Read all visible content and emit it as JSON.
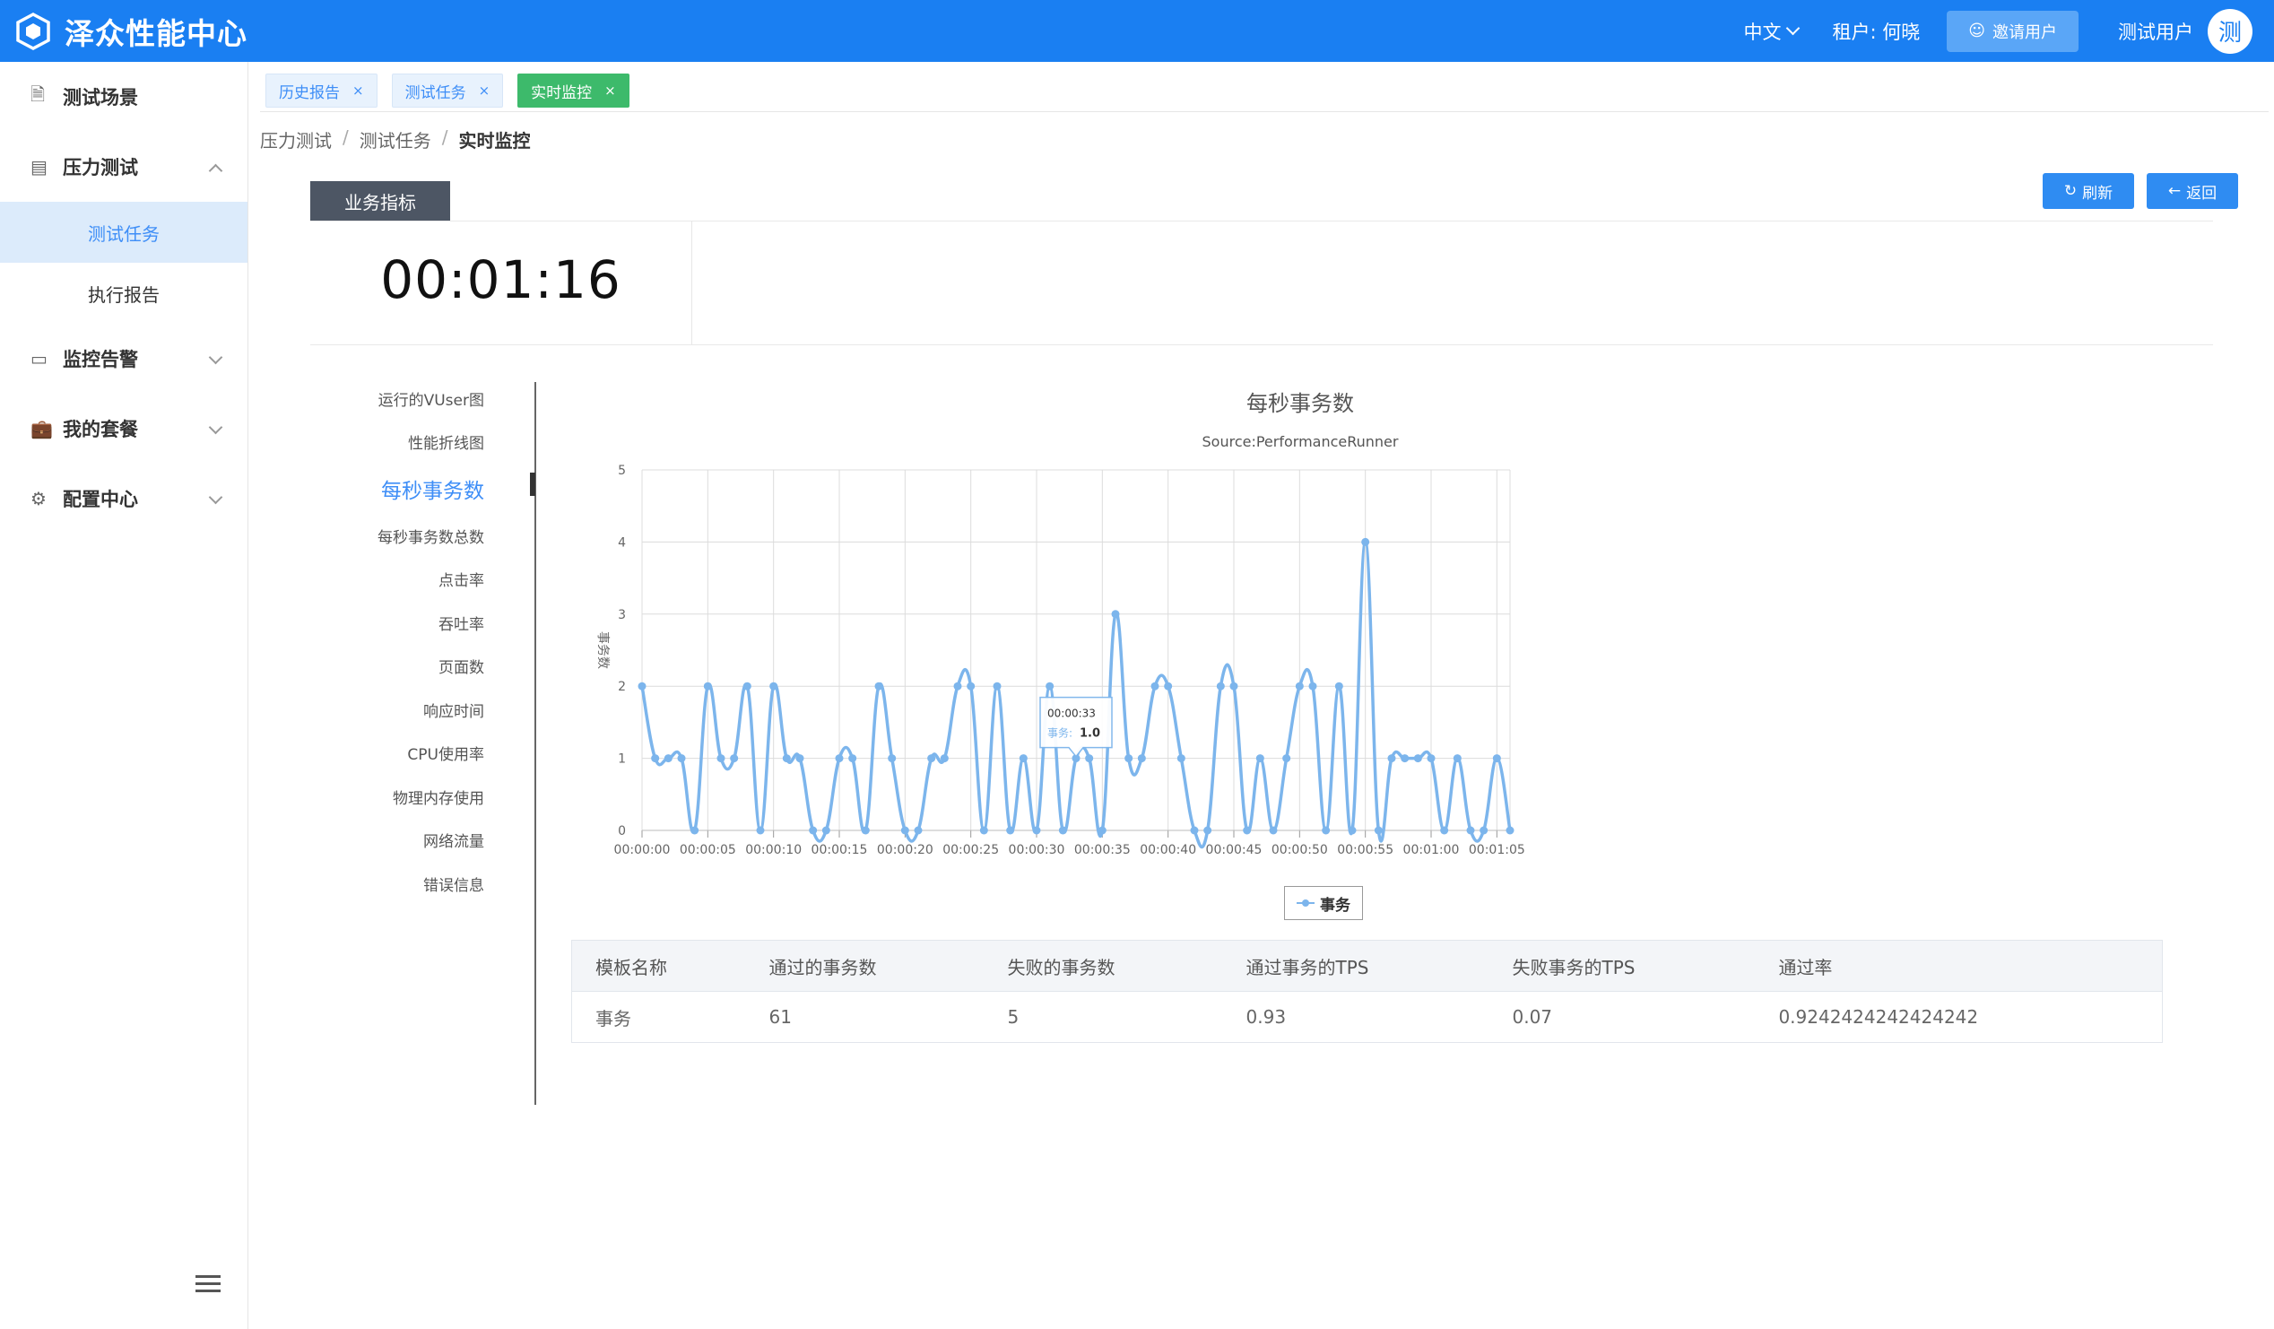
{
  "header": {
    "brand_name": "泽众性能中心",
    "language": "中文",
    "tenant": "租户: 何晓",
    "invite_label": "邀请用户",
    "username": "测试用户",
    "avatar_text": "测"
  },
  "sidebar": {
    "items": [
      {
        "label": "测试场景",
        "icon": "document-icon"
      },
      {
        "label": "压力测试",
        "icon": "monitor-icon",
        "expanded": true,
        "children": [
          {
            "label": "测试任务",
            "active": true
          },
          {
            "label": "执行报告"
          }
        ]
      },
      {
        "label": "监控告警",
        "icon": "desktop-icon"
      },
      {
        "label": "我的套餐",
        "icon": "bag-icon"
      },
      {
        "label": "配置中心",
        "icon": "gear-icon"
      }
    ]
  },
  "tabs": [
    {
      "label": "历史报告",
      "active": false
    },
    {
      "label": "测试任务",
      "active": false
    },
    {
      "label": "实时监控",
      "active": true
    }
  ],
  "breadcrumb": [
    "压力测试",
    "测试任务",
    "实时监控"
  ],
  "section_tab": "业务指标",
  "buttons": {
    "refresh": "刷新",
    "back": "返回"
  },
  "timer": "00:01:16",
  "chart_nav": [
    {
      "label": "运行的VUser图"
    },
    {
      "label": "性能折线图"
    },
    {
      "label": "每秒事务数",
      "active": true
    },
    {
      "label": "每秒事务数总数"
    },
    {
      "label": "点击率"
    },
    {
      "label": "吞吐率"
    },
    {
      "label": "页面数"
    },
    {
      "label": "响应时间"
    },
    {
      "label": "CPU使用率"
    },
    {
      "label": "物理内存使用"
    },
    {
      "label": "网络流量"
    },
    {
      "label": "错误信息"
    }
  ],
  "chart_data": {
    "type": "line",
    "title": "每秒事务数",
    "subtitle": "Source:PerformanceRunner",
    "ylabel": "事务数",
    "xlabel": "",
    "ylim": [
      0,
      5
    ],
    "yticks": [
      0,
      1,
      2,
      3,
      4,
      5
    ],
    "xticks": [
      "00:00:00",
      "00:00:05",
      "00:00:10",
      "00:00:15",
      "00:00:20",
      "00:00:25",
      "00:00:30",
      "00:00:35",
      "00:00:40",
      "00:00:45",
      "00:00:50",
      "00:00:55",
      "00:01:00",
      "00:01:05"
    ],
    "grid": true,
    "legend": "bottom-center",
    "series": [
      {
        "name": "事务",
        "color": "#7cb5ec",
        "values": [
          2,
          1,
          1,
          1,
          0,
          2,
          1,
          1,
          2,
          0,
          2,
          1,
          1,
          0,
          0,
          1,
          1,
          0,
          2,
          1,
          0,
          0,
          1,
          1,
          2,
          2,
          0,
          2,
          0,
          1,
          0,
          2,
          0,
          1,
          1,
          0,
          3,
          1,
          1,
          2,
          2,
          1,
          0,
          0,
          2,
          2,
          0,
          1,
          0,
          1,
          2,
          2,
          0,
          2,
          0,
          4,
          0,
          1,
          1,
          1,
          1,
          0,
          1,
          0,
          0,
          1,
          0
        ]
      }
    ],
    "tooltip": {
      "time": "00:00:33",
      "series": "事务",
      "value": "1.0"
    }
  },
  "table": {
    "headers": [
      "模板名称",
      "通过的事务数",
      "失败的事务数",
      "通过事务的TPS",
      "失败事务的TPS",
      "通过率"
    ],
    "rows": [
      [
        "事务",
        "61",
        "5",
        "0.93",
        "0.07",
        "0.9242424242424242"
      ]
    ]
  }
}
